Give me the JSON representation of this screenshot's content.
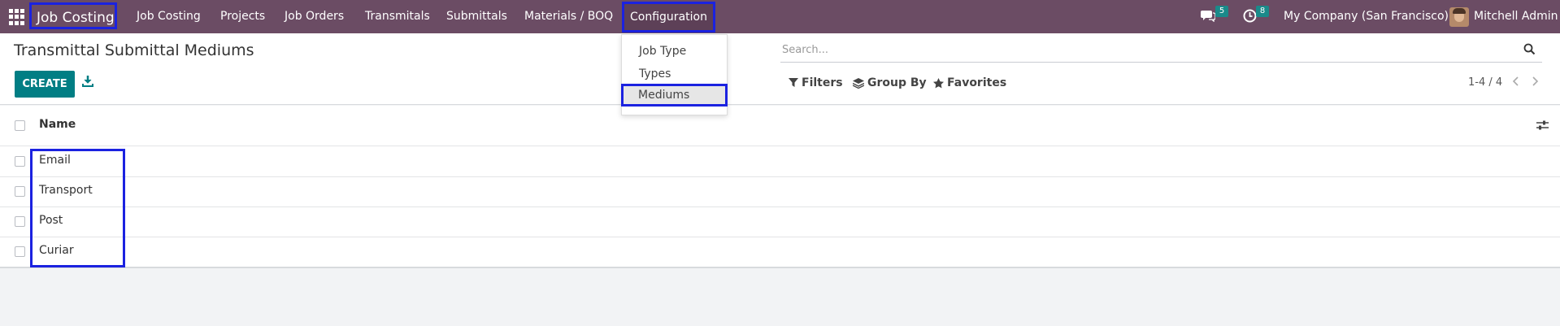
{
  "navbar": {
    "brand": "Job Costing",
    "menu": [
      "Job Costing",
      "Projects",
      "Job Orders",
      "Transmitals",
      "Submittals",
      "Materials / BOQ"
    ],
    "active_menu": "Configuration",
    "messages_count": "5",
    "activities_count": "8",
    "company": "My Company (San Francisco)",
    "user": "Mitchell Admin",
    "icons": {
      "apps": "apps-grid-icon",
      "messages": "chat-icon",
      "activities": "clock-icon"
    }
  },
  "dropdown": {
    "items": [
      "Job Type",
      "Types",
      "Mediums"
    ],
    "active": "Mediums"
  },
  "control_panel": {
    "title": "Transmittal Submittal Mediums",
    "create_label": "CREATE",
    "search_placeholder": "Search...",
    "filters_label": "Filters",
    "group_by_label": "Group By",
    "favorites_label": "Favorites",
    "pager": "1-4 / 4"
  },
  "list": {
    "column_header": "Name",
    "rows": [
      "Email",
      "Transport",
      "Post",
      "Curiar"
    ]
  },
  "colors": {
    "navbar": "#6b4c64",
    "primary": "#017e84",
    "highlight": "#1b22e0",
    "badge": "#1a8a8a"
  }
}
